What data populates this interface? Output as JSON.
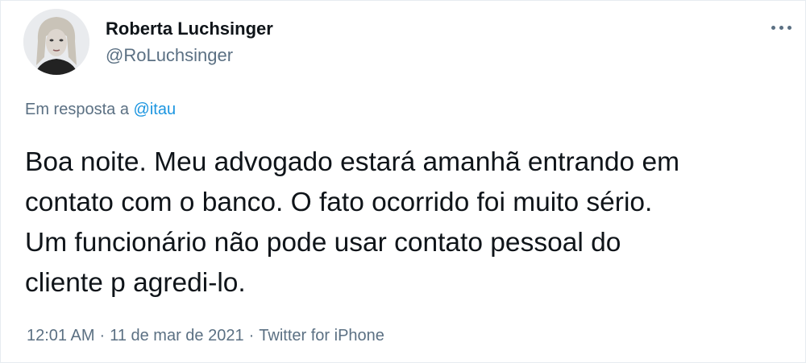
{
  "author": {
    "display_name": "Roberta Luchsinger",
    "handle": "@RoLuchsinger",
    "avatar": "avatar-photo"
  },
  "more_icon": "more-horizontal-icon",
  "reply": {
    "prefix": "Em resposta a",
    "mention": "@itau"
  },
  "tweet": {
    "lines": [
      "Boa noite. Meu advogado estará amanhã entrando em",
      "contato com o banco. O fato ocorrido foi muito sério.",
      "Um funcionário não pode usar contato pessoal do",
      "cliente p agredi-lo."
    ]
  },
  "meta": {
    "time": "12:01 AM",
    "separator": "·",
    "date": "11 de mar de 2021",
    "source": "Twitter for iPhone"
  },
  "colors": {
    "text": "#0f1419",
    "secondary": "#5b7083",
    "link": "#1b95e0",
    "border": "#e6ecf0"
  }
}
